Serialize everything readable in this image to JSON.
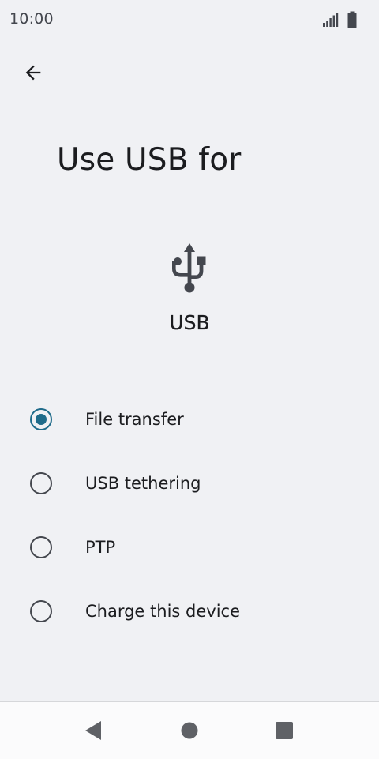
{
  "status_bar": {
    "time": "10:00",
    "icons": [
      "signal-icon",
      "battery-icon"
    ]
  },
  "header": {
    "back_icon": "arrow-back-icon",
    "title": "Use USB for"
  },
  "device": {
    "icon": "usb-icon",
    "label": "USB"
  },
  "options": [
    {
      "label": "File transfer",
      "checked": true
    },
    {
      "label": "USB tethering",
      "checked": false
    },
    {
      "label": "PTP",
      "checked": false
    },
    {
      "label": "Charge this device",
      "checked": false
    }
  ],
  "nav_bar": {
    "icons": [
      "back-triangle-icon",
      "home-circle-icon",
      "recents-square-icon"
    ]
  },
  "colors": {
    "background": "#f0f1f4",
    "accent": "#1f6b8a",
    "icon": "#44474e",
    "nav_background": "#fbfbfc"
  }
}
